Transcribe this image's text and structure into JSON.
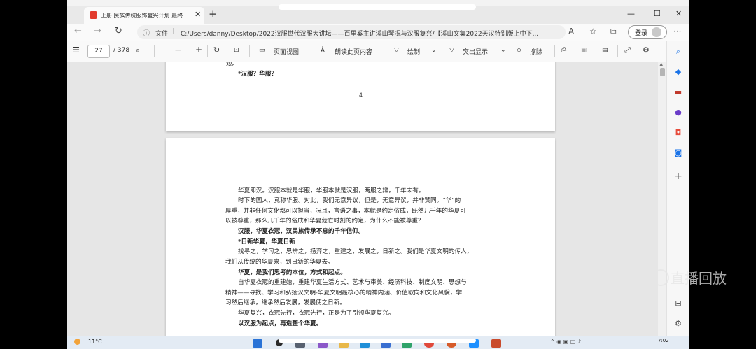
{
  "browser": {
    "tab_title": "上册 民族传统服饰复兴计划 最终",
    "tab_close": "✕",
    "new_tab": "+",
    "window_min": "—",
    "window_max": "☐",
    "window_close": "✕",
    "url_scheme": "文件",
    "url": "C:/Users/danny/Desktop/2022汉服世代汉服大讲坛——百里奚主讲溪山琴况与汉服复兴/【溪山文集2022天汉特别版上中下...",
    "login_label": "登录",
    "more": "···"
  },
  "pdf_toolbar": {
    "page_current": "27",
    "page_total": "/ 378",
    "zoom_out": "—",
    "zoom_in": "+",
    "page_view": "页面视图",
    "read_aloud": "朗读此页内容",
    "draw": "绘制",
    "highlight": "突出显示",
    "erase": "擦除"
  },
  "page_top": {
    "line_cont": "观。",
    "heading": "*汉服？华服？",
    "page_number": "4"
  },
  "page_main": {
    "lines": [
      {
        "text": "华夏即汉。汉服本就是华服，华服本就是汉服，两服之辩，千年未有。",
        "bold": false,
        "indent": true
      },
      {
        "text": "时下的国人，竟称华服。对此，我们无意异议，但是，无意异议，并非赞同。“华”的",
        "bold": false,
        "indent": true
      },
      {
        "text": "厚重，并非任何文化都可以担当，况且，言语之事，本就是约定俗成，既然几千年的华夏可",
        "bold": false,
        "indent": false
      },
      {
        "text": "以被尊重，那么几千年的俗成和华夏危亡时刻的约定，为什么不能被尊重？",
        "bold": false,
        "indent": false
      },
      {
        "text": "汉服，华夏衣冠，汉民族传承不息的千年信仰。",
        "bold": true,
        "indent": true
      },
      {
        "text": "*日新华夏，华夏日新",
        "bold": true,
        "indent": true
      },
      {
        "text": "找寻之，学习之，思辨之，扬弃之，重建之，发展之，日新之。我们是华夏文明的传人，",
        "bold": false,
        "indent": true
      },
      {
        "text": "我们从传统的华夏来，到日新的华夏去。",
        "bold": false,
        "indent": false
      },
      {
        "text": "华夏，是我们思考的本位，方式和起点。",
        "bold": true,
        "indent": true
      },
      {
        "text": "自华夏衣冠的重建始，重建华夏生活方式、艺术与审美、经济科技、制度文明、思想与",
        "bold": false,
        "indent": true
      },
      {
        "text": "精神——寻找、学习和弘扬汉文明-华夏文明最核心的精神内涵、价值取向和文化风貌，学",
        "bold": false,
        "indent": false
      },
      {
        "text": "习然后继承，继承然后发展，发展使之日新。",
        "bold": false,
        "indent": false
      },
      {
        "text": "华夏复兴，衣冠先行，衣冠先行，正是为了引领华夏复兴。",
        "bold": false,
        "indent": true
      },
      {
        "text": "以汉服为起点，再造整个华夏。",
        "bold": true,
        "indent": true
      }
    ]
  },
  "taskbar": {
    "weather": "11°C",
    "time": "7:02"
  },
  "watermark": "直播回放"
}
